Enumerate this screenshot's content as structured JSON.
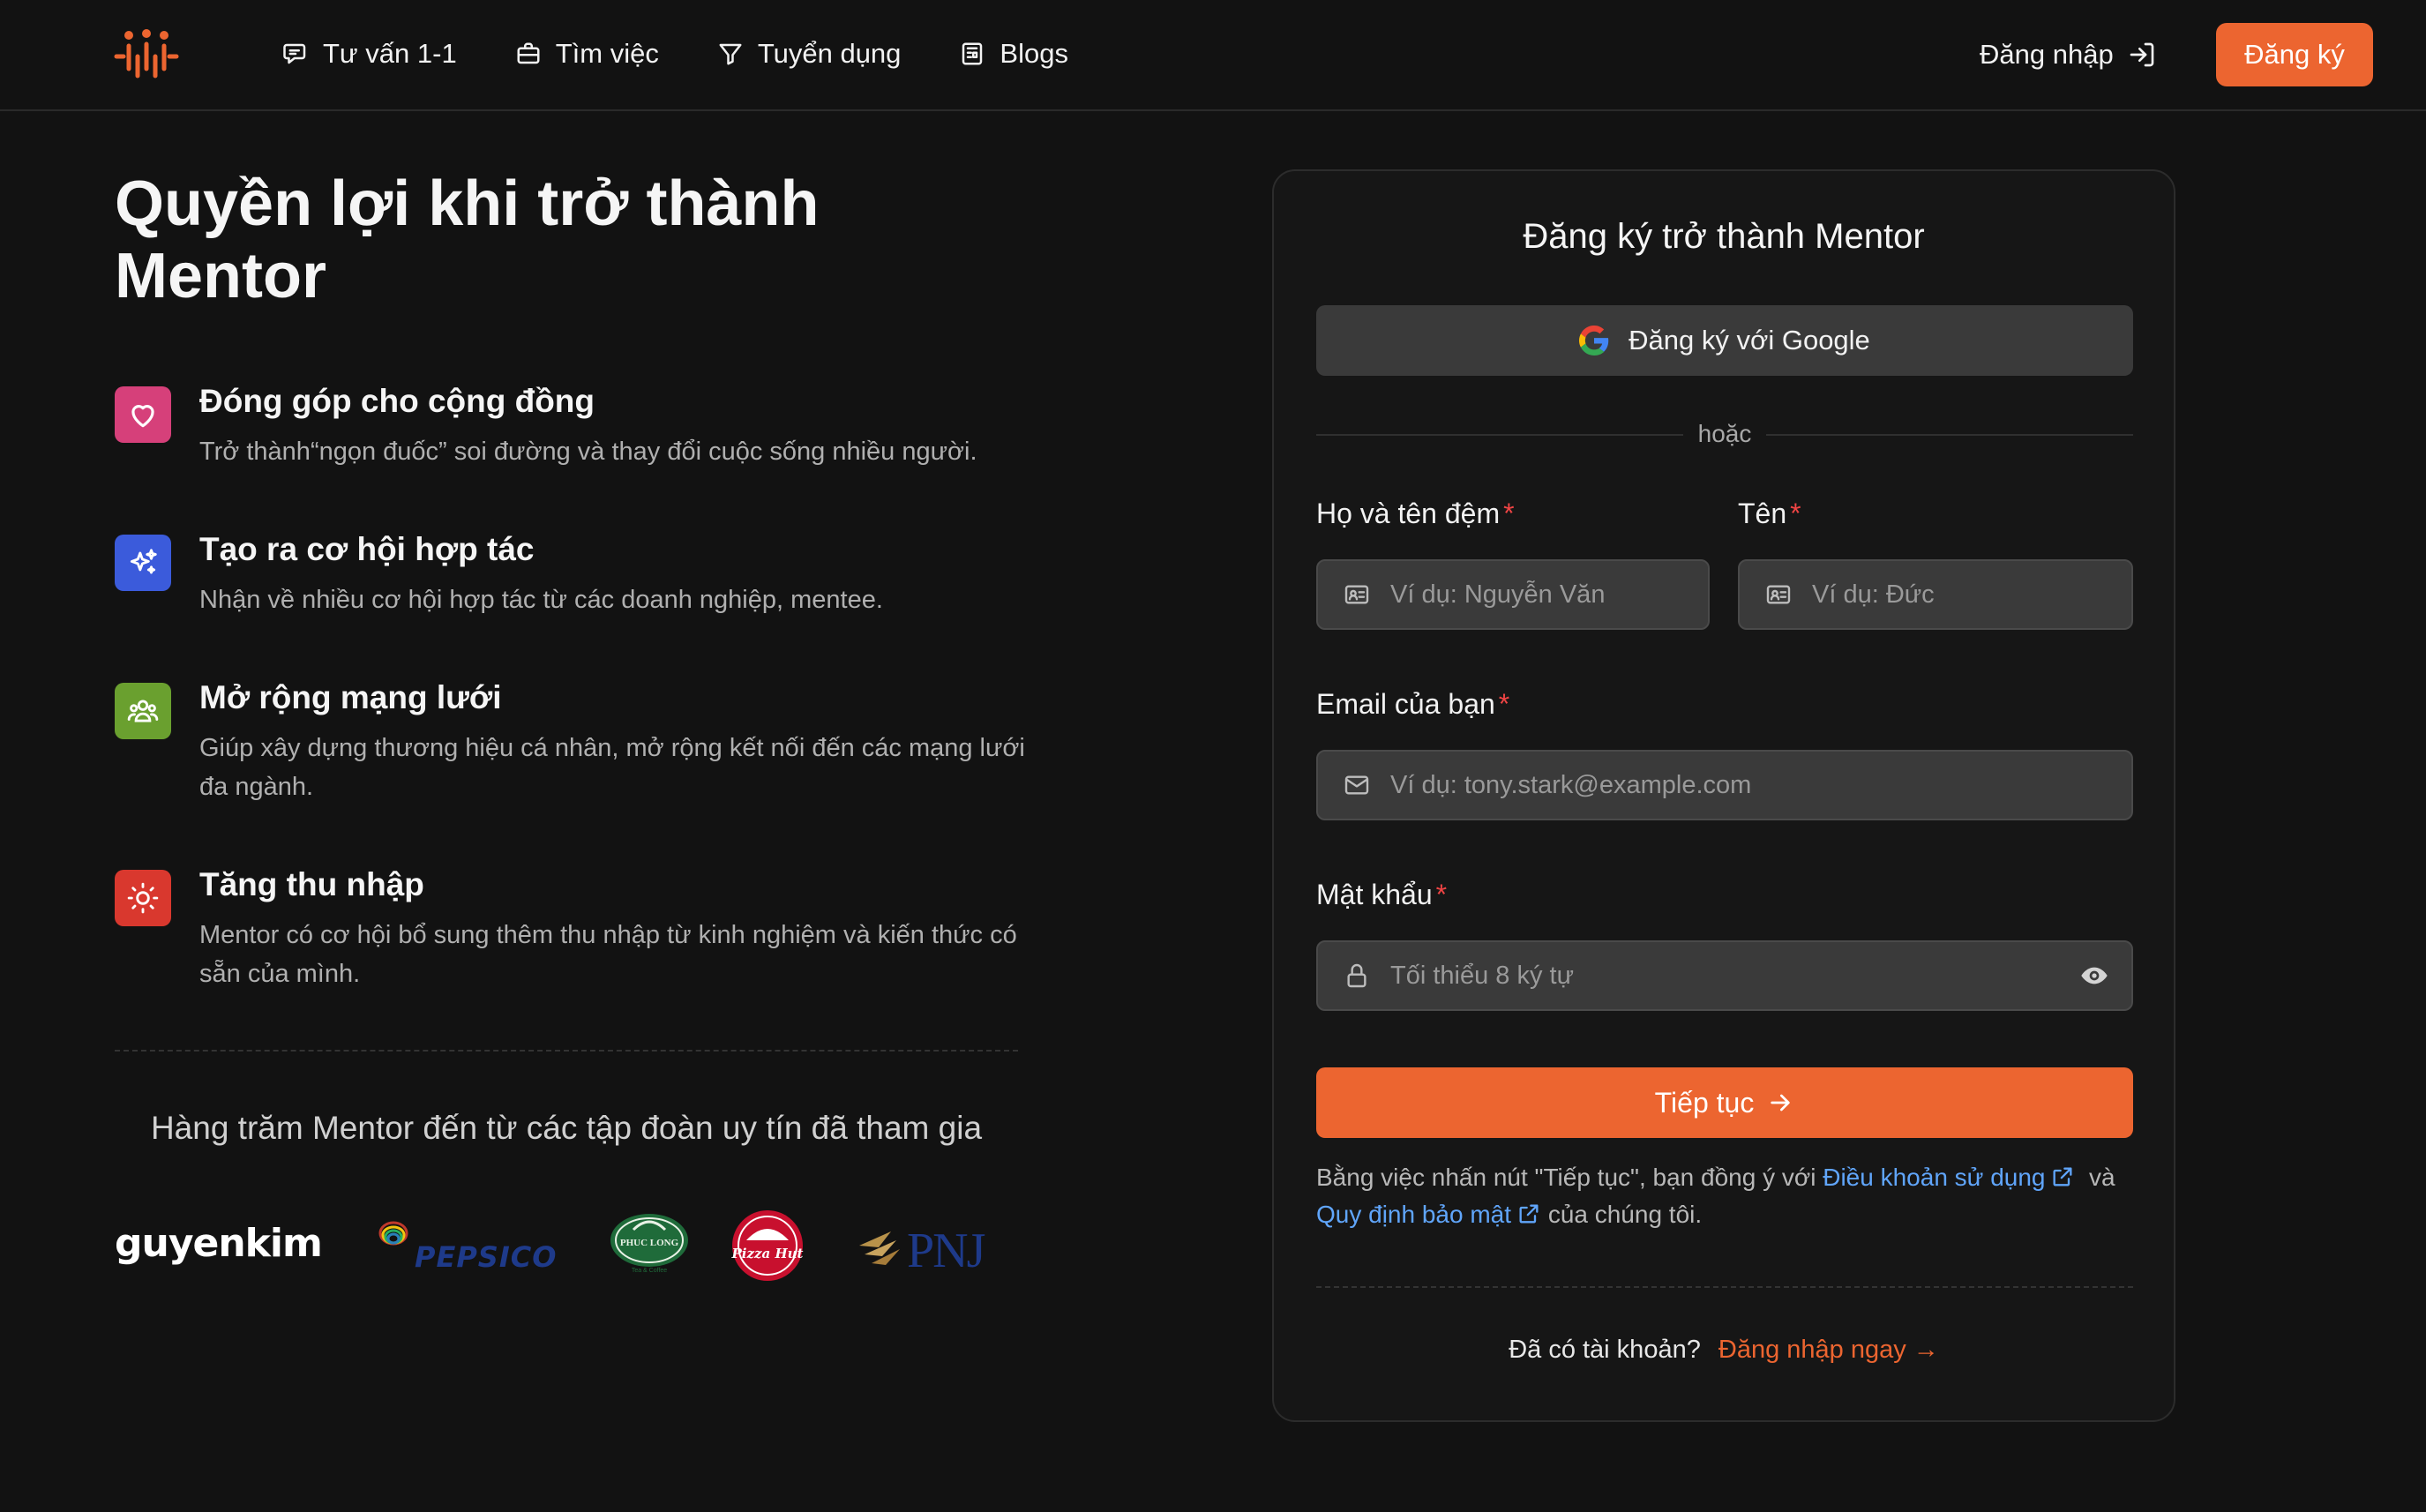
{
  "header": {
    "nav": [
      {
        "label": "Tư vấn 1-1",
        "icon": "chat-bubble-icon"
      },
      {
        "label": "Tìm việc",
        "icon": "briefcase-icon"
      },
      {
        "label": "Tuyển dụng",
        "icon": "filter-icon"
      },
      {
        "label": "Blogs",
        "icon": "newspaper-icon"
      }
    ],
    "login_label": "Đăng nhập",
    "signup_label": "Đăng ký"
  },
  "hero": {
    "title_line1": "Quyền lợi khi trở thành",
    "title_line2": "Mentor"
  },
  "benefits": [
    {
      "title": "Đóng góp cho cộng đồng",
      "desc": "Trở thành“ngọn đuốc” soi đường và thay đổi cuộc sống nhiều người.",
      "icon": "heart-icon",
      "color": "#d6407a"
    },
    {
      "title": "Tạo ra cơ hội hợp tác",
      "desc": "Nhận về nhiều cơ hội hợp tác từ các doanh nghiệp, mentee.",
      "icon": "sparkles-icon",
      "color": "#3b5bdb"
    },
    {
      "title": "Mở rộng mạng lưới",
      "desc": "Giúp xây dựng thương hiệu cá nhân, mở rộng kết nối đến các mạng lưới đa ngành.",
      "icon": "users-icon",
      "color": "#6aa02f"
    },
    {
      "title": "Tăng thu nhập",
      "desc": "Mentor có cơ hội bổ sung thêm thu nhập từ kinh nghiệm và kiến thức có sẵn của mình.",
      "icon": "sun-icon",
      "color": "#d9382e"
    }
  ],
  "partners": {
    "caption": "Hàng trăm Mentor đến từ các tập đoàn uy tín đã tham gia",
    "logos": {
      "nguyenkim": "guyenkim",
      "pepsico": "PEPSICO",
      "phuclong": "PHUC LONG",
      "pizzahut": "Pizza Hut",
      "pnj": "PNJ"
    }
  },
  "form": {
    "title": "Đăng ký trở thành Mentor",
    "google_label": "Đăng ký với Google",
    "or_text": "hoặc",
    "middle_name_label": "Họ và tên đệm",
    "middle_name_placeholder": "Ví dụ: Nguyễn Văn",
    "first_name_label": "Tên",
    "first_name_placeholder": "Ví dụ: Đức",
    "email_label": "Email của bạn",
    "email_placeholder": "Ví dụ: tony.stark@example.com",
    "password_label": "Mật khẩu",
    "password_placeholder": "Tối thiểu 8 ký tự",
    "required_mark": "*",
    "continue_label": "Tiếp tục",
    "terms_prefix": "Bằng việc nhấn nút \"Tiếp tục\", bạn đồng ý với",
    "terms_link": "Điều khoản sử dụng",
    "terms_and": "và",
    "privacy_link": "Quy định bảo mật",
    "terms_suffix": "của chúng tôi.",
    "have_account": "Đã có tài khoản?",
    "login_now": "Đăng nhập ngay →"
  },
  "colors": {
    "accent": "#ec6530",
    "link": "#60a5fa",
    "required": "#ef4444",
    "background": "#121212"
  }
}
